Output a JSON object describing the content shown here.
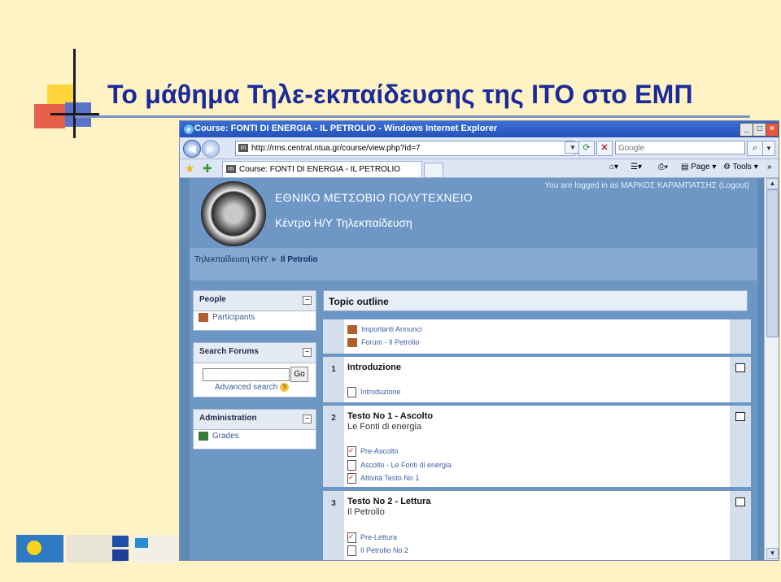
{
  "slide": {
    "title": "Το μάθημα Τηλε-εκπαίδευσης της ΙΤΟ στο ΕΜΠ"
  },
  "browser": {
    "window_title": "Course: FONTI DI ENERGIA - IL PETROLIO - Windows Internet Explorer",
    "url": "http://rms.central.ntua.gr/course/view.php?id=7",
    "search_placeholder": "Google",
    "tab_label": "Course: FONTI DI ENERGIA - IL PETROLIO",
    "tools": {
      "page": "Page",
      "tools": "Tools"
    },
    "buttons": {
      "minimize": "_",
      "maximize": "□",
      "close": "×",
      "back": "◀",
      "forward": "▶"
    }
  },
  "site": {
    "institution": "ΕΘΝΙΚΟ ΜΕΤΣΟΒΙΟ ΠΟΛΥΤΕΧΝΕΙΟ",
    "center": "Κέντρο Η/Υ Τηλεκπαίδευση",
    "login_text": "You are logged in as ΜΑΡΚΟΣ ΚΑΡΑΜΠΑΤΣΗΣ (Logout)",
    "breadcrumb_home": "Τηλεκπαίδευση ΚΗΥ",
    "breadcrumb_sep": "►",
    "breadcrumb_current": "Il Petrolio"
  },
  "blocks": {
    "people": {
      "title": "People",
      "participants": "Participants"
    },
    "search": {
      "title": "Search Forums",
      "go": "Go",
      "advanced": "Advanced search"
    },
    "admin": {
      "title": "Administration",
      "grades": "Grades"
    }
  },
  "topics": {
    "header": "Topic outline",
    "section0": {
      "items": [
        "Importanti Annunci",
        "Forum - Il Petrolio"
      ]
    },
    "section1": {
      "num": "1",
      "title": "Introduzione",
      "items": [
        "Introduzione"
      ]
    },
    "section2": {
      "num": "2",
      "title": "Testo No 1 - Ascolto",
      "subtitle": "Le Fonti di energia",
      "items": [
        "Pre-Ascolto",
        "Ascolto - Le Fonti di energia",
        "Attività Testo No 1"
      ]
    },
    "section3": {
      "num": "3",
      "title": "Testo No 2 - Lettura",
      "subtitle": "Il Petrolio",
      "items": [
        "Pre-Lettura",
        "Il Petrolio No 2"
      ]
    }
  },
  "colors": {
    "title": "#1A2A9A",
    "slide_bg": "#FFF2C4",
    "page_bg": "#6C96C4"
  }
}
